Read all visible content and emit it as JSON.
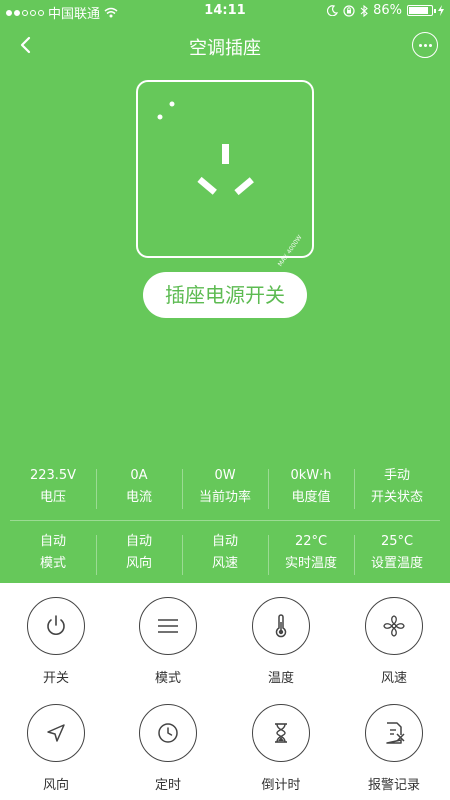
{
  "status_bar": {
    "carrier": "中国联通",
    "time": "14:11",
    "battery_pct": "86%",
    "battery_level": 0.86
  },
  "nav": {
    "title": "空调插座"
  },
  "socket": {
    "rating": "MAX 4000W"
  },
  "power_switch": {
    "label": "插座电源开关"
  },
  "stats": {
    "row1": [
      {
        "value": "223.5V",
        "label": "电压"
      },
      {
        "value": "0A",
        "label": "电流"
      },
      {
        "value": "0W",
        "label": "当前功率"
      },
      {
        "value": "0kW·h",
        "label": "电度值"
      },
      {
        "value": "手动",
        "label": "开关状态"
      }
    ],
    "row2": [
      {
        "value": "自动",
        "label": "模式"
      },
      {
        "value": "自动",
        "label": "风向"
      },
      {
        "value": "自动",
        "label": "风速"
      },
      {
        "value": "22°C",
        "label": "实时温度"
      },
      {
        "value": "25°C",
        "label": "设置温度"
      }
    ]
  },
  "controls": [
    {
      "label": "开关",
      "icon": "power-icon"
    },
    {
      "label": "模式",
      "icon": "menu-lines-icon"
    },
    {
      "label": "温度",
      "icon": "thermometer-icon"
    },
    {
      "label": "风速",
      "icon": "fan-icon"
    },
    {
      "label": "风向",
      "icon": "navigation-arrow-icon"
    },
    {
      "label": "定时",
      "icon": "clock-icon"
    },
    {
      "label": "倒计时",
      "icon": "hourglass-icon"
    },
    {
      "label": "报警记录",
      "icon": "alarm-record-icon"
    }
  ],
  "colors": {
    "brand_green": "#66c85a"
  }
}
